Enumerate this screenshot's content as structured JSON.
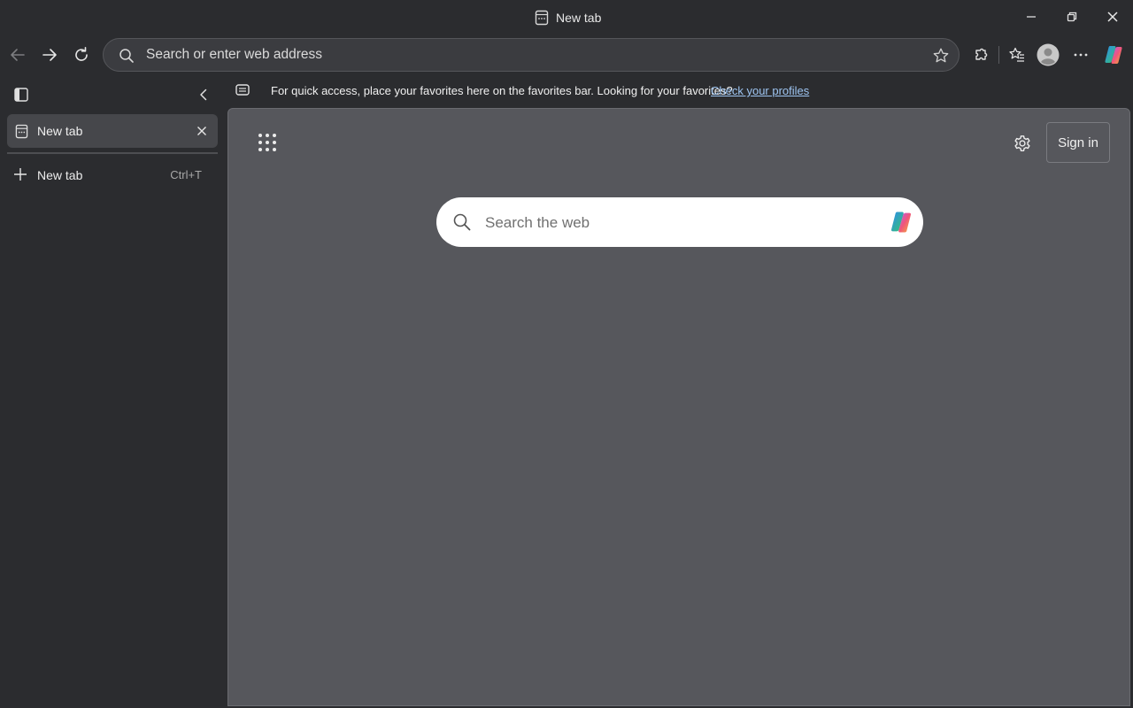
{
  "window": {
    "title": "New tab"
  },
  "toolbar": {
    "back_icon": "arrow-left-icon",
    "forward_icon": "arrow-right-icon",
    "refresh_icon": "refresh-icon",
    "address_placeholder": "Search or enter web address",
    "icons": [
      "extensions-icon",
      "favorites-icon",
      "profile-icon",
      "more-icon",
      "copilot-icon"
    ]
  },
  "sidebar": {
    "tabs": [
      {
        "label": "New tab",
        "active": true
      }
    ],
    "new_tab": {
      "label": "New tab",
      "shortcut": "Ctrl+T"
    }
  },
  "favorites_bar": {
    "message": "For quick access, place your favorites here on the favorites bar. Looking for your favorites?",
    "link": "Check your profiles"
  },
  "newtab_page": {
    "sign_in_label": "Sign in",
    "search_placeholder": "Search the web"
  },
  "colors": {
    "chrome_bg": "#2b2c2f",
    "content_bg": "#56575c",
    "link": "#9ec5f2",
    "active_tab": "#46474b"
  }
}
